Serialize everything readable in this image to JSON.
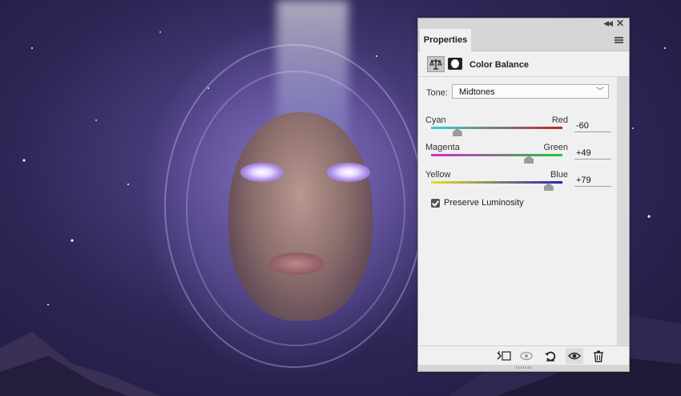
{
  "panel": {
    "tab_label": "Properties",
    "adjustment_title": "Color Balance",
    "tone": {
      "label": "Tone:",
      "selected": "Midtones"
    },
    "sliders": [
      {
        "left": "Cyan",
        "right": "Red",
        "value": "-60",
        "level": -60,
        "gradient": [
          "#31d6cf",
          "#c4232a"
        ]
      },
      {
        "left": "Magenta",
        "right": "Green",
        "value": "+49",
        "level": 49,
        "gradient": [
          "#d62ad0",
          "#22c63a"
        ]
      },
      {
        "left": "Yellow",
        "right": "Blue",
        "value": "+79",
        "level": 79,
        "gradient": [
          "#e6e21e",
          "#2323b8"
        ]
      }
    ],
    "preserve_luminosity": {
      "label": "Preserve Luminosity",
      "checked": true
    },
    "footer_icons": [
      "clip-to-layer-icon",
      "view-previous-state-icon",
      "reset-icon",
      "visibility-icon",
      "delete-icon"
    ]
  }
}
